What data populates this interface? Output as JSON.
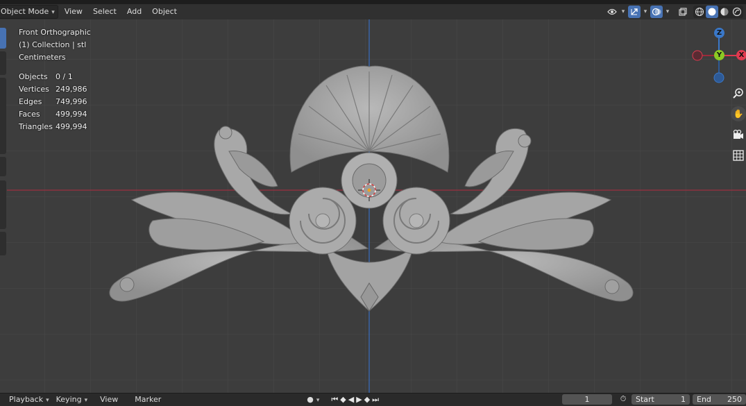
{
  "header": {
    "mode_label": "Object Mode",
    "menus": [
      "View",
      "Select",
      "Add",
      "Object"
    ]
  },
  "viewport": {
    "view_name": "Front Orthographic",
    "collection": "(1) Collection | stl",
    "units": "Centimeters",
    "stats": [
      {
        "label": "Objects",
        "value": "0 / 1"
      },
      {
        "label": "Vertices",
        "value": "249,986"
      },
      {
        "label": "Edges",
        "value": "749,996"
      },
      {
        "label": "Faces",
        "value": "499,994"
      },
      {
        "label": "Triangles",
        "value": "499,994"
      }
    ],
    "gizmo": {
      "z_label": "Z",
      "y_label": "Y",
      "x_label": "X"
    },
    "colors": {
      "x_axis": "#e0394f",
      "y_axis": "#8bc924",
      "z_axis": "#3a78c9",
      "background": "#3d3d3d",
      "grid": "#494949",
      "model": "#a9a9a9"
    }
  },
  "timeline": {
    "playback_label": "Playback",
    "keying_label": "Keying",
    "view_label": "View",
    "marker_label": "Marker",
    "current_frame": "1",
    "start_label": "Start",
    "start_value": "1",
    "end_label": "End",
    "end_value": "250"
  },
  "icons": [
    "visibility-icon",
    "gizmo-icon",
    "overlay-icon",
    "xray-icon",
    "wireframe-shading-icon",
    "solid-shading-icon",
    "material-shading-icon",
    "rendered-shading-icon",
    "zoom-icon",
    "pan-hand-icon",
    "camera-icon",
    "grid-icon",
    "jump-start-icon",
    "prev-keyframe-icon",
    "play-reverse-icon",
    "play-icon",
    "next-keyframe-icon",
    "jump-end-icon",
    "stopwatch-icon",
    "record-icon"
  ]
}
